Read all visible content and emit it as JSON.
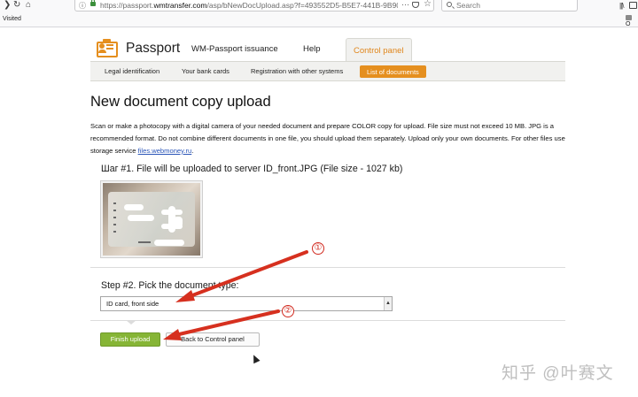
{
  "browser": {
    "url_host_prefix": "https://passport.",
    "url_host": "wmtransfer.com",
    "url_path": "/asp/bNewDocUpload.asp?f=493552D5-B5E7-441B-9B90",
    "more_glyph": "···",
    "search_placeholder": "Search",
    "bookmarks": {
      "visited": "Visited",
      "other": "O"
    }
  },
  "header": {
    "brand": "Passport",
    "tabs": [
      {
        "label": "WM-Passport issuance"
      },
      {
        "label": "Help"
      },
      {
        "label": "Control panel",
        "active": true
      }
    ]
  },
  "subnav": {
    "items": [
      {
        "label": "Legal identification"
      },
      {
        "label": "Your bank cards"
      },
      {
        "label": "Registration with other systems"
      },
      {
        "label": "List of documents",
        "active": true
      }
    ]
  },
  "page": {
    "title": "New document copy upload",
    "description": "Scan or make a photocopy with a digital camera of your needed document and prepare COLOR copy for upload. File size must not exceed 10 MB. JPG is a recommended format. Do not combine different documents in one file, you should upload them separately. Upload only your own documents. For other files use storage service ",
    "storage_link": "files.webmoney.ru",
    "description_end": ".",
    "step1": "Шаг #1. File will be uploaded to server ID_front.JPG (File size - 1027 kb)",
    "step2": "Step #2. Pick the document type:",
    "doc_type_selected": "ID card, front side",
    "finish_button": "Finish upload",
    "back_button": "Back to Control panel"
  },
  "annotations": {
    "marker_1": "①",
    "marker_2": "②",
    "arrow_color": "#d6301f",
    "watermark": "知乎 @叶赛文"
  },
  "colors": {
    "accent": "#e58f1f",
    "finish_button": "#86b536",
    "link": "#2a55b8"
  }
}
